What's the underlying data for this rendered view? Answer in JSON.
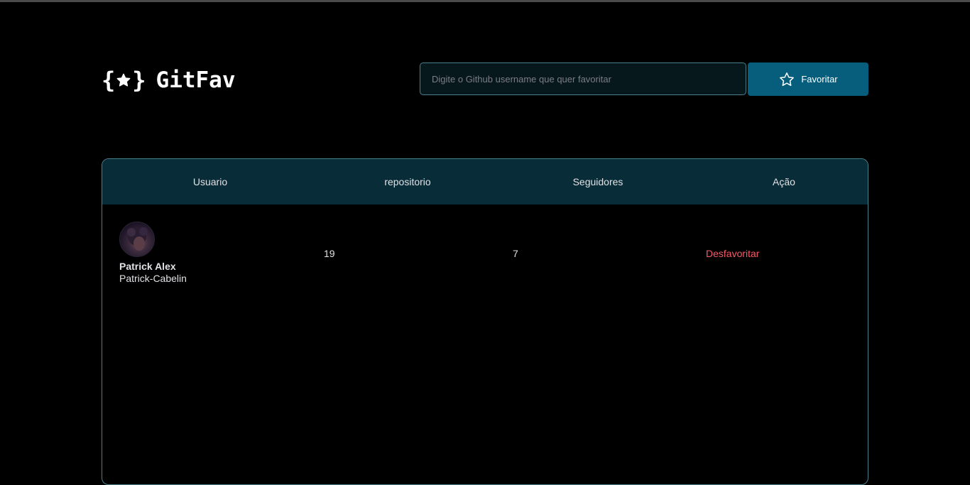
{
  "app": {
    "title": "GitFav"
  },
  "search": {
    "placeholder": "Digite o Github username que quer favoritar",
    "value": ""
  },
  "favorite_button": {
    "label": "Favoritar",
    "icon": "star-outline-icon"
  },
  "table": {
    "headers": [
      "Usuario",
      "repositorio",
      "Seguidores",
      "Ação"
    ],
    "rows": [
      {
        "name": "Patrick Alex",
        "login": "Patrick-Cabelin",
        "repositories": "19",
        "followers": "7",
        "action": "Desfavoritar"
      }
    ]
  },
  "colors": {
    "background": "#000000",
    "header_row": "#092d38",
    "button": "#065e7c",
    "border": "#4a808c",
    "danger": "#f75a68"
  }
}
